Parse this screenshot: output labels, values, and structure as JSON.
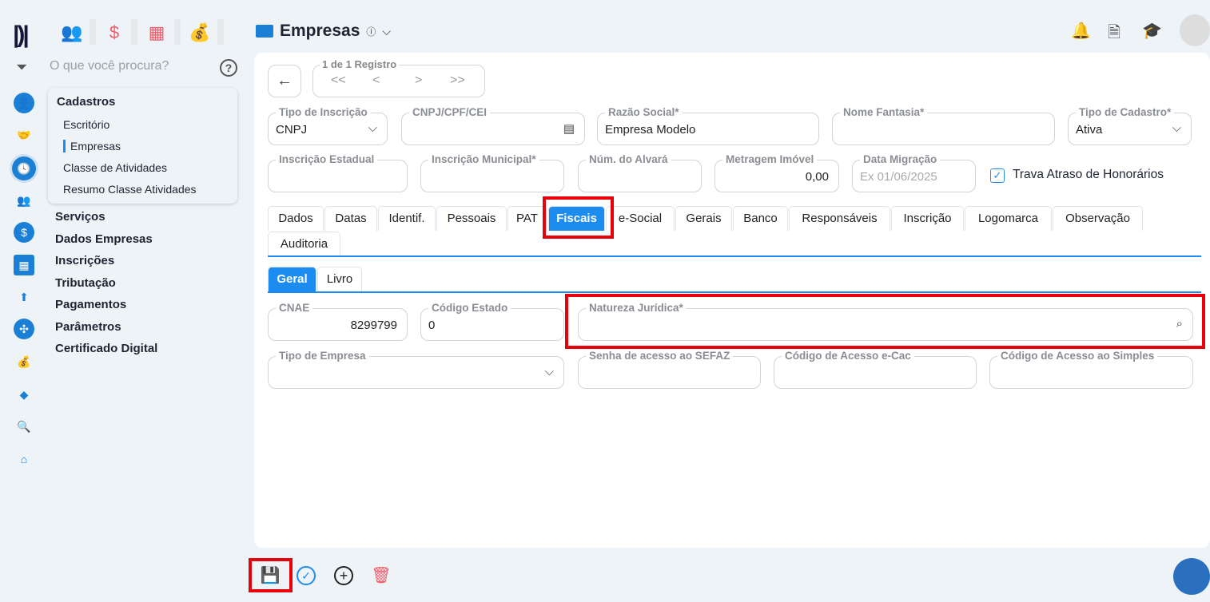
{
  "header": {
    "title": "Empresas",
    "info_icon": "info-icon"
  },
  "search": {
    "placeholder": "O que você procura?",
    "help": "?"
  },
  "submenu": {
    "title": "Cadastros",
    "items": [
      "Escritório",
      "Empresas",
      "Classe de Atividades",
      "Resumo Classe Atividades"
    ],
    "active": "Empresas"
  },
  "menu": [
    "Serviços",
    "Dados Empresas",
    "Inscrições",
    "Tributação",
    "Pagamentos",
    "Parâmetros",
    "Certificado Digital"
  ],
  "navigator": {
    "label": "1 de 1 Registro",
    "first": "<<",
    "prev": "<",
    "next": ">",
    "last": ">>"
  },
  "fields": {
    "tipo_inscricao": {
      "label": "Tipo de Inscrição",
      "value": "CNPJ"
    },
    "cnpj": {
      "label": "CNPJ/CPF/CEI",
      "value": ""
    },
    "razao_social": {
      "label": "Razão Social*",
      "value": "Empresa Modelo"
    },
    "nome_fantasia": {
      "label": "Nome Fantasia*",
      "value": ""
    },
    "tipo_cadastro": {
      "label": "Tipo de Cadastro*",
      "value": "Ativa"
    },
    "insc_estadual": {
      "label": "Inscrição Estadual",
      "value": ""
    },
    "insc_municipal": {
      "label": "Inscrição Municipal*",
      "value": ""
    },
    "alvara": {
      "label": "Núm. do Alvará",
      "value": ""
    },
    "metragem": {
      "label": "Metragem Imóvel",
      "value": "0,00"
    },
    "data_migracao": {
      "label": "Data Migração",
      "placeholder": "Ex 01/06/2025"
    },
    "cnae": {
      "label": "CNAE",
      "value": "8299799"
    },
    "codigo_estado": {
      "label": "Código Estado",
      "value": "0"
    },
    "natureza": {
      "label": "Natureza Jurídica*",
      "value": ""
    },
    "tipo_empresa": {
      "label": "Tipo de Empresa",
      "value": ""
    },
    "senha_sefaz": {
      "label": "Senha de acesso ao SEFAZ",
      "value": ""
    },
    "ecac": {
      "label": "Código de Acesso e-Cac",
      "value": ""
    },
    "simples": {
      "label": "Código de Acesso ao Simples",
      "value": ""
    }
  },
  "checkbox": {
    "label": "Trava Atraso de Honorários",
    "checked": true
  },
  "tabs": [
    "Dados",
    "Datas",
    "Identif.",
    "Pessoais",
    "PAT",
    "Fiscais",
    "e-Social",
    "Gerais",
    "Banco",
    "Responsáveis",
    "Inscrição",
    "Logomarca",
    "Observação",
    "Auditoria"
  ],
  "active_tab": "Fiscais",
  "subtabs": [
    "Geral",
    "Livro"
  ],
  "active_subtab": "Geral",
  "colors": {
    "accent": "#1d8cf0",
    "highlight": "#e8000b",
    "save": "#1aa55a",
    "delete": "#f05a6a"
  }
}
